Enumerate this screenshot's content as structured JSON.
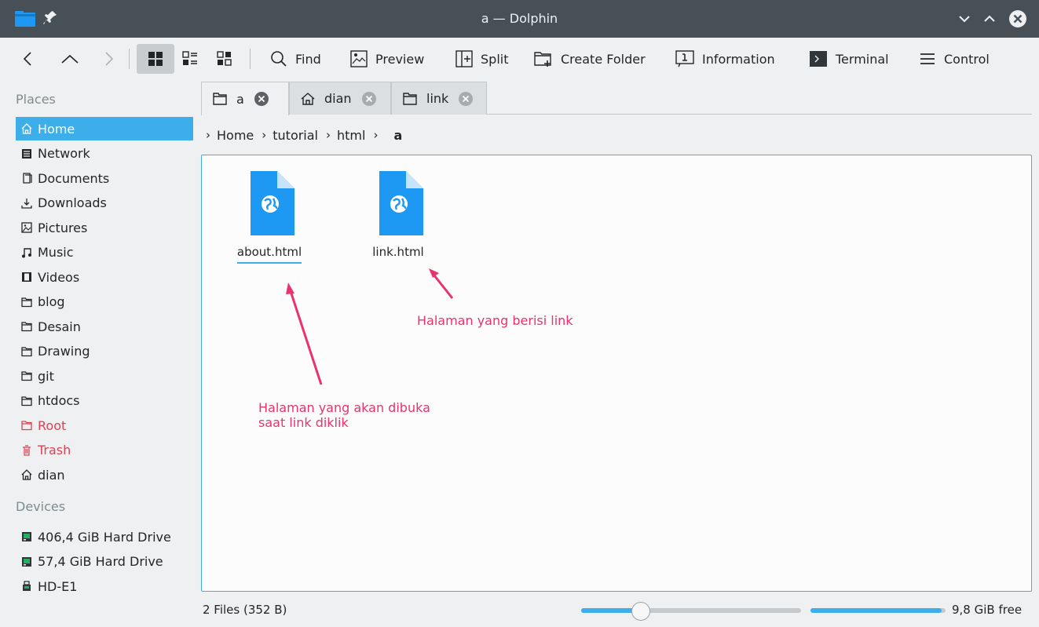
{
  "window": {
    "title": "a — Dolphin"
  },
  "toolbar": {
    "back_icon": "chevron-left-icon",
    "up_icon": "chevron-up-icon",
    "forward_icon": "chevron-right-icon",
    "find_label": "Find",
    "preview_label": "Preview",
    "split_label": "Split",
    "create_folder_label": "Create Folder",
    "information_label": "Information",
    "terminal_label": "Terminal",
    "control_label": "Control"
  },
  "places": {
    "title": "Places",
    "items": [
      {
        "label": "Home",
        "icon": "home-icon",
        "selected": true
      },
      {
        "label": "Network",
        "icon": "network-icon"
      },
      {
        "label": "Documents",
        "icon": "documents-icon"
      },
      {
        "label": "Downloads",
        "icon": "downloads-icon"
      },
      {
        "label": "Pictures",
        "icon": "pictures-icon"
      },
      {
        "label": "Music",
        "icon": "music-icon"
      },
      {
        "label": "Videos",
        "icon": "videos-icon"
      },
      {
        "label": "blog",
        "icon": "folder-icon"
      },
      {
        "label": "Desain",
        "icon": "folder-icon"
      },
      {
        "label": "Drawing",
        "icon": "folder-icon"
      },
      {
        "label": "git",
        "icon": "folder-icon"
      },
      {
        "label": "htdocs",
        "icon": "folder-icon"
      },
      {
        "label": "Root",
        "icon": "folder-red-icon"
      },
      {
        "label": "Trash",
        "icon": "trash-icon"
      },
      {
        "label": "dian",
        "icon": "home-icon"
      }
    ]
  },
  "devices": {
    "title": "Devices",
    "items": [
      {
        "label": "406,4 GiB Hard Drive",
        "icon": "hard-drive-icon"
      },
      {
        "label": "57,4 GiB Hard Drive",
        "icon": "hard-drive-icon"
      },
      {
        "label": "HD-E1",
        "icon": "usb-drive-icon"
      }
    ]
  },
  "tabs": [
    {
      "label": "a",
      "icon": "folder-icon",
      "active": true
    },
    {
      "label": "dian",
      "icon": "home-icon"
    },
    {
      "label": "link",
      "icon": "folder-icon"
    }
  ],
  "breadcrumb": [
    "Home",
    "tutorial",
    "html",
    "a"
  ],
  "files": [
    {
      "name": "about.html",
      "icon": "html-file-icon"
    },
    {
      "name": "link.html",
      "icon": "html-file-icon"
    }
  ],
  "annotations": {
    "link_note": "Halaman yang berisi link",
    "about_note_line1": "Halaman yang akan dibuka",
    "about_note_line2": "saat link diklik"
  },
  "status": {
    "summary": "2 Files (352 B)",
    "zoom_level": 0.27,
    "disk_used_fraction": 0.97,
    "free_space": "9,8 GiB free"
  },
  "colors": {
    "accent": "#3daee9",
    "annotation": "#e8336c",
    "titlebar": "#475057",
    "danger": "#da4453"
  }
}
